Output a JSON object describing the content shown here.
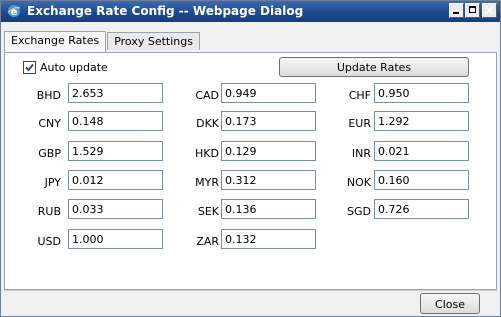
{
  "window": {
    "title": "Exchange Rate Config -- Webpage Dialog",
    "icon": "ie-icon",
    "controls": [
      "minimize-icon",
      "maximize-icon",
      "close-icon"
    ],
    "close_glyph": "×"
  },
  "tabs": [
    {
      "label": "Exchange Rates",
      "active": true
    },
    {
      "label": "Proxy Settings",
      "active": false
    }
  ],
  "auto_update": {
    "label": "Auto update",
    "checked": true
  },
  "update_button": {
    "label": "Update Rates"
  },
  "rates": [
    {
      "code": "BHD",
      "value": "2.653"
    },
    {
      "code": "CAD",
      "value": "0.949"
    },
    {
      "code": "CHF",
      "value": "0.950"
    },
    {
      "code": "CNY",
      "value": "0.148"
    },
    {
      "code": "DKK",
      "value": "0.173"
    },
    {
      "code": "EUR",
      "value": "1.292"
    },
    {
      "code": "GBP",
      "value": "1.529"
    },
    {
      "code": "HKD",
      "value": "0.129"
    },
    {
      "code": "INR",
      "value": "0.021"
    },
    {
      "code": "JPY",
      "value": "0.012"
    },
    {
      "code": "MYR",
      "value": "0.312"
    },
    {
      "code": "NOK",
      "value": "0.160"
    },
    {
      "code": "RUB",
      "value": "0.033"
    },
    {
      "code": "SEK",
      "value": "0.136"
    },
    {
      "code": "SGD",
      "value": "0.726"
    },
    {
      "code": "USD",
      "value": "1.000"
    },
    {
      "code": "ZAR",
      "value": "0.132"
    }
  ],
  "close_button": {
    "label": "Close"
  },
  "colors": {
    "titlebar": "#1d4a92",
    "input_border": "#7a8ea8",
    "checkbox": "#1c5180"
  }
}
